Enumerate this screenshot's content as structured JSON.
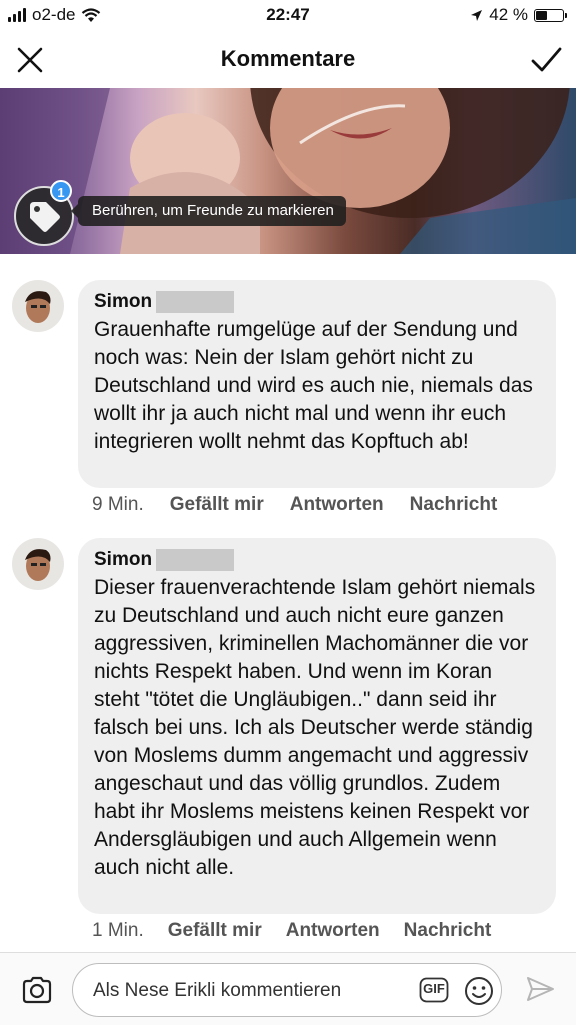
{
  "status_bar": {
    "carrier": "o2-de",
    "time": "22:47",
    "battery_percent": "42 %",
    "battery_level": 0.42
  },
  "header": {
    "title": "Kommentare",
    "close_icon": "close-icon",
    "done_icon": "checkmark-icon"
  },
  "photo": {
    "tag_badge_count": "1",
    "tag_hint": "Berühren, um Freunde zu markieren",
    "tag_icon": "tag-icon"
  },
  "comments": [
    {
      "username": "Simon",
      "text": "Grauenhafte rumgelüge auf der Sendung und noch was: Nein der Islam gehört nicht zu Deutschland und wird es auch nie, niemals das wollt ihr ja auch nicht mal und wenn ihr euch integrieren wollt nehmt das Kopftuch ab!",
      "time": "9 Min.",
      "like_label": "Gefällt mir",
      "reply_label": "Antworten",
      "message_label": "Nachricht"
    },
    {
      "username": "Simon",
      "text": "Dieser frauenverachtende Islam gehört niemals zu Deutschland und auch nicht eure ganzen aggressiven, kriminellen Machomänner die vor nichts Respekt haben. Und wenn im Koran steht \"tötet die Ungläubigen..\" dann seid ihr falsch bei uns. Ich als Deutscher werde ständig von Moslems dumm angemacht und aggressiv angeschaut und das völlig grundlos. Zudem habt ihr Moslems meistens keinen Respekt vor Andersgläubigen und auch Allgemein wenn auch nicht alle.",
      "time": "1 Min.",
      "like_label": "Gefällt mir",
      "reply_label": "Antworten",
      "message_label": "Nachricht"
    }
  ],
  "composer": {
    "placeholder": "Als Nese Erikli kommentieren",
    "gif_label": "GIF",
    "camera_icon": "camera-icon",
    "emoji_icon": "emoji-icon",
    "send_icon": "send-icon"
  },
  "colors": {
    "accent": "#3897f0",
    "bubble": "#efefef",
    "secondary_text": "#555555"
  }
}
